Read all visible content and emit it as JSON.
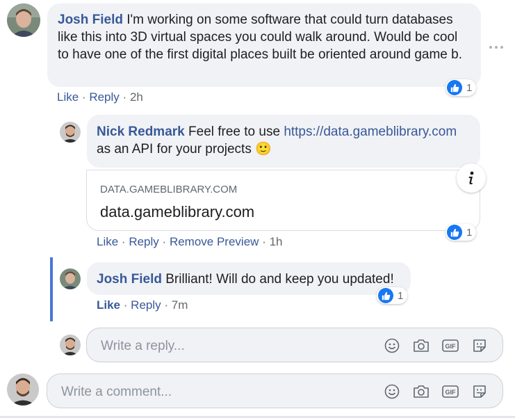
{
  "comments": [
    {
      "author": "Josh Field",
      "text": "I'm working on some software that could turn databases like this into 3D virtual spaces you could walk around. Would be cool to have one of the first digital places built be oriented around game b.",
      "actions": {
        "like": "Like",
        "reply": "Reply",
        "time": "2h"
      },
      "reaction_count": "1",
      "replies": [
        {
          "author": "Nick Redmark",
          "text_before": "Feel free to use ",
          "link": "https://data.gameblibrary.com",
          "text_after": " as an API for your projects",
          "emoji": "🙂",
          "preview": {
            "domain": "DATA.GAMEBLIBRARY.COM",
            "title": "data.gameblibrary.com"
          },
          "actions": {
            "like": "Like",
            "reply": "Reply",
            "remove_preview": "Remove Preview",
            "time": "1h"
          },
          "reaction_count": "1"
        },
        {
          "author": "Josh Field",
          "text": "Brilliant! Will do and keep you updated!",
          "actions": {
            "like": "Like",
            "reply": "Reply",
            "time": "7m"
          },
          "reaction_count": "1"
        }
      ]
    }
  ],
  "reply_input": {
    "placeholder": "Write a reply..."
  },
  "comment_input": {
    "placeholder": "Write a comment..."
  },
  "separator": "·",
  "colors": {
    "link": "#385898",
    "bubble": "#f0f2f5",
    "reaction": "#1877f2",
    "thread_line": "#4a76d8"
  },
  "icons": [
    "more-options-icon",
    "like-thumb-icon",
    "info-icon",
    "emoji-icon",
    "camera-icon",
    "gif-icon",
    "sticker-icon"
  ]
}
